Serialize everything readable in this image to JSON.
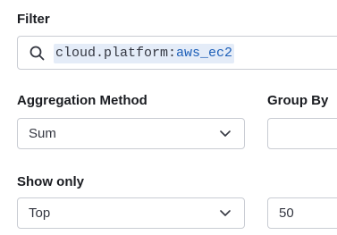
{
  "filter": {
    "label": "Filter",
    "query_key": "cloud.platform:",
    "query_value": "aws_ec2"
  },
  "aggregation": {
    "label": "Aggregation Method",
    "value": "Sum"
  },
  "group_by": {
    "label": "Group By",
    "value": ""
  },
  "show_only": {
    "label": "Show only",
    "value": "Top"
  },
  "limit": {
    "value": "50"
  }
}
